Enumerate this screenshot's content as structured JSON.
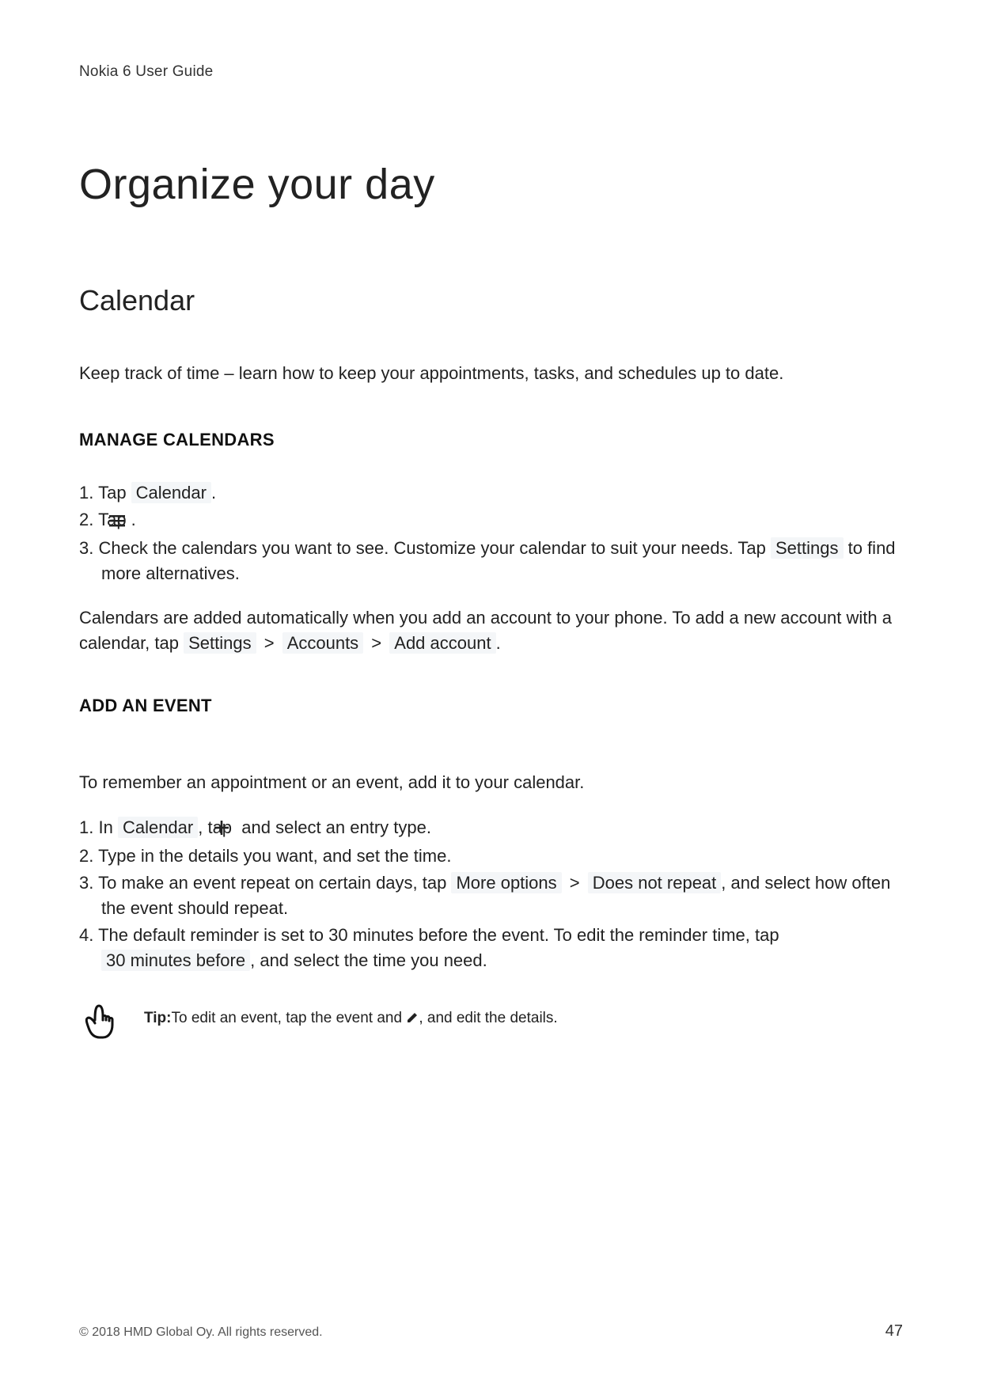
{
  "header": {
    "doc_title": "Nokia 6 User Guide"
  },
  "title": "Organize your day",
  "section": {
    "title": "Calendar"
  },
  "intro": "Keep track of time – learn how to keep your appointments, tasks, and schedules up to date.",
  "subsections": {
    "manage": {
      "heading": "MANAGE CALENDARS",
      "steps": {
        "s1_a": "Tap ",
        "s1_label": "Calendar",
        "s1_b": ".",
        "s2_a": "Tap ",
        "s2_b": ".",
        "s3_a": "Check the calendars you want to see. Customize your calendar to suit your needs. Tap ",
        "s3_label": "Settings",
        "s3_b": " to find more alternatives."
      },
      "para_a": "Calendars are added automatically when you add an account to your phone. To add a new account with a calendar, tap ",
      "para_label1": "Settings",
      "para_sep1": " > ",
      "para_label2": "Accounts",
      "para_sep2": " > ",
      "para_label3": "Add account",
      "para_b": "."
    },
    "add_event": {
      "heading": "ADD AN EVENT",
      "intro": "To remember an appointment or an event, add it to your calendar.",
      "steps": {
        "s1_a": "In ",
        "s1_label": "Calendar",
        "s1_b": ", tap ",
        "s1_c": " and select an entry type.",
        "s2": "Type in the details you want, and set the time.",
        "s3_a": "To make an event repeat on certain days, tap ",
        "s3_label1": "More options",
        "s3_sep": " > ",
        "s3_label2": "Does not repeat",
        "s3_b": ", and select how often the event should repeat.",
        "s4_a": "The default reminder is set to 30 minutes before the event. To edit the reminder time, tap ",
        "s4_label": "30 minutes before",
        "s4_b": ", and select the time you need."
      },
      "tip_label": "Tip:",
      "tip_a": "To edit an event, tap the event and ",
      "tip_b": ", and edit the details."
    }
  },
  "footer": {
    "copyright": "© 2018 HMD Global Oy. All rights reserved.",
    "page": "47"
  },
  "icons": {
    "menu": "menu-icon",
    "plus": "plus-icon",
    "pencil": "pencil-icon",
    "pointer": "tip-pointer-icon"
  }
}
